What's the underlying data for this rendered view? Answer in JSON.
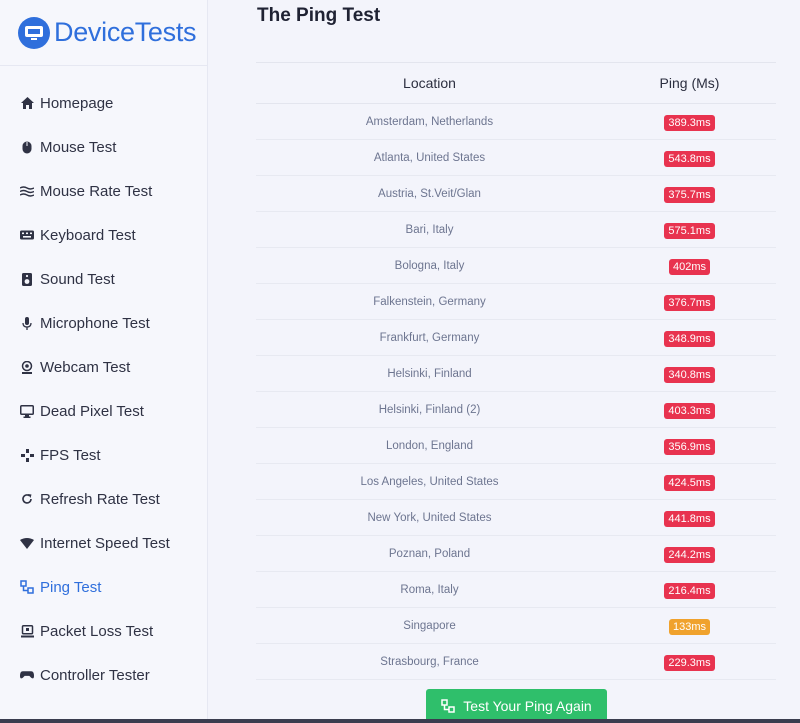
{
  "brand": {
    "name": "DeviceTests"
  },
  "sidebar": {
    "items": [
      {
        "label": "Homepage",
        "icon": "home-icon",
        "active": false
      },
      {
        "label": "Mouse Test",
        "icon": "mouse-icon",
        "active": false
      },
      {
        "label": "Mouse Rate Test",
        "icon": "waves-icon",
        "active": false
      },
      {
        "label": "Keyboard Test",
        "icon": "keyboard-icon",
        "active": false
      },
      {
        "label": "Sound Test",
        "icon": "speaker-icon",
        "active": false
      },
      {
        "label": "Microphone Test",
        "icon": "microphone-icon",
        "active": false
      },
      {
        "label": "Webcam Test",
        "icon": "webcam-icon",
        "active": false
      },
      {
        "label": "Dead Pixel Test",
        "icon": "monitor-icon",
        "active": false
      },
      {
        "label": "FPS Test",
        "icon": "crosshair-icon",
        "active": false
      },
      {
        "label": "Refresh Rate Test",
        "icon": "refresh-icon",
        "active": false
      },
      {
        "label": "Internet Speed Test",
        "icon": "wifi-icon",
        "active": false
      },
      {
        "label": "Ping Test",
        "icon": "network-icon",
        "active": true
      },
      {
        "label": "Packet Loss Test",
        "icon": "packet-icon",
        "active": false
      },
      {
        "label": "Controller Tester",
        "icon": "gamepad-icon",
        "active": false
      }
    ]
  },
  "main": {
    "title": "The Ping Test",
    "table": {
      "headers": {
        "location": "Location",
        "ping": "Ping (Ms)"
      },
      "rows": [
        {
          "location": "Amsterdam, Netherlands",
          "ping": "389.3ms",
          "status": "bad"
        },
        {
          "location": "Atlanta, United States",
          "ping": "543.8ms",
          "status": "bad"
        },
        {
          "location": "Austria, St.Veit/Glan",
          "ping": "375.7ms",
          "status": "bad"
        },
        {
          "location": "Bari, Italy",
          "ping": "575.1ms",
          "status": "bad"
        },
        {
          "location": "Bologna, Italy",
          "ping": "402ms",
          "status": "bad"
        },
        {
          "location": "Falkenstein, Germany",
          "ping": "376.7ms",
          "status": "bad"
        },
        {
          "location": "Frankfurt, Germany",
          "ping": "348.9ms",
          "status": "bad"
        },
        {
          "location": "Helsinki, Finland",
          "ping": "340.8ms",
          "status": "bad"
        },
        {
          "location": "Helsinki, Finland (2)",
          "ping": "403.3ms",
          "status": "bad"
        },
        {
          "location": "London, England",
          "ping": "356.9ms",
          "status": "bad"
        },
        {
          "location": "Los Angeles, United States",
          "ping": "424.5ms",
          "status": "bad"
        },
        {
          "location": "New York, United States",
          "ping": "441.8ms",
          "status": "bad"
        },
        {
          "location": "Poznan, Poland",
          "ping": "244.2ms",
          "status": "bad"
        },
        {
          "location": "Roma, Italy",
          "ping": "216.4ms",
          "status": "bad"
        },
        {
          "location": "Singapore",
          "ping": "133ms",
          "status": "warn"
        },
        {
          "location": "Strasbourg, France",
          "ping": "229.3ms",
          "status": "bad"
        }
      ]
    },
    "cta_label": "Test Your Ping Again"
  },
  "colors": {
    "accent": "#2f6fdc",
    "bad": "#e8334f",
    "warn": "#f0a22d",
    "cta": "#2fbf6b"
  }
}
